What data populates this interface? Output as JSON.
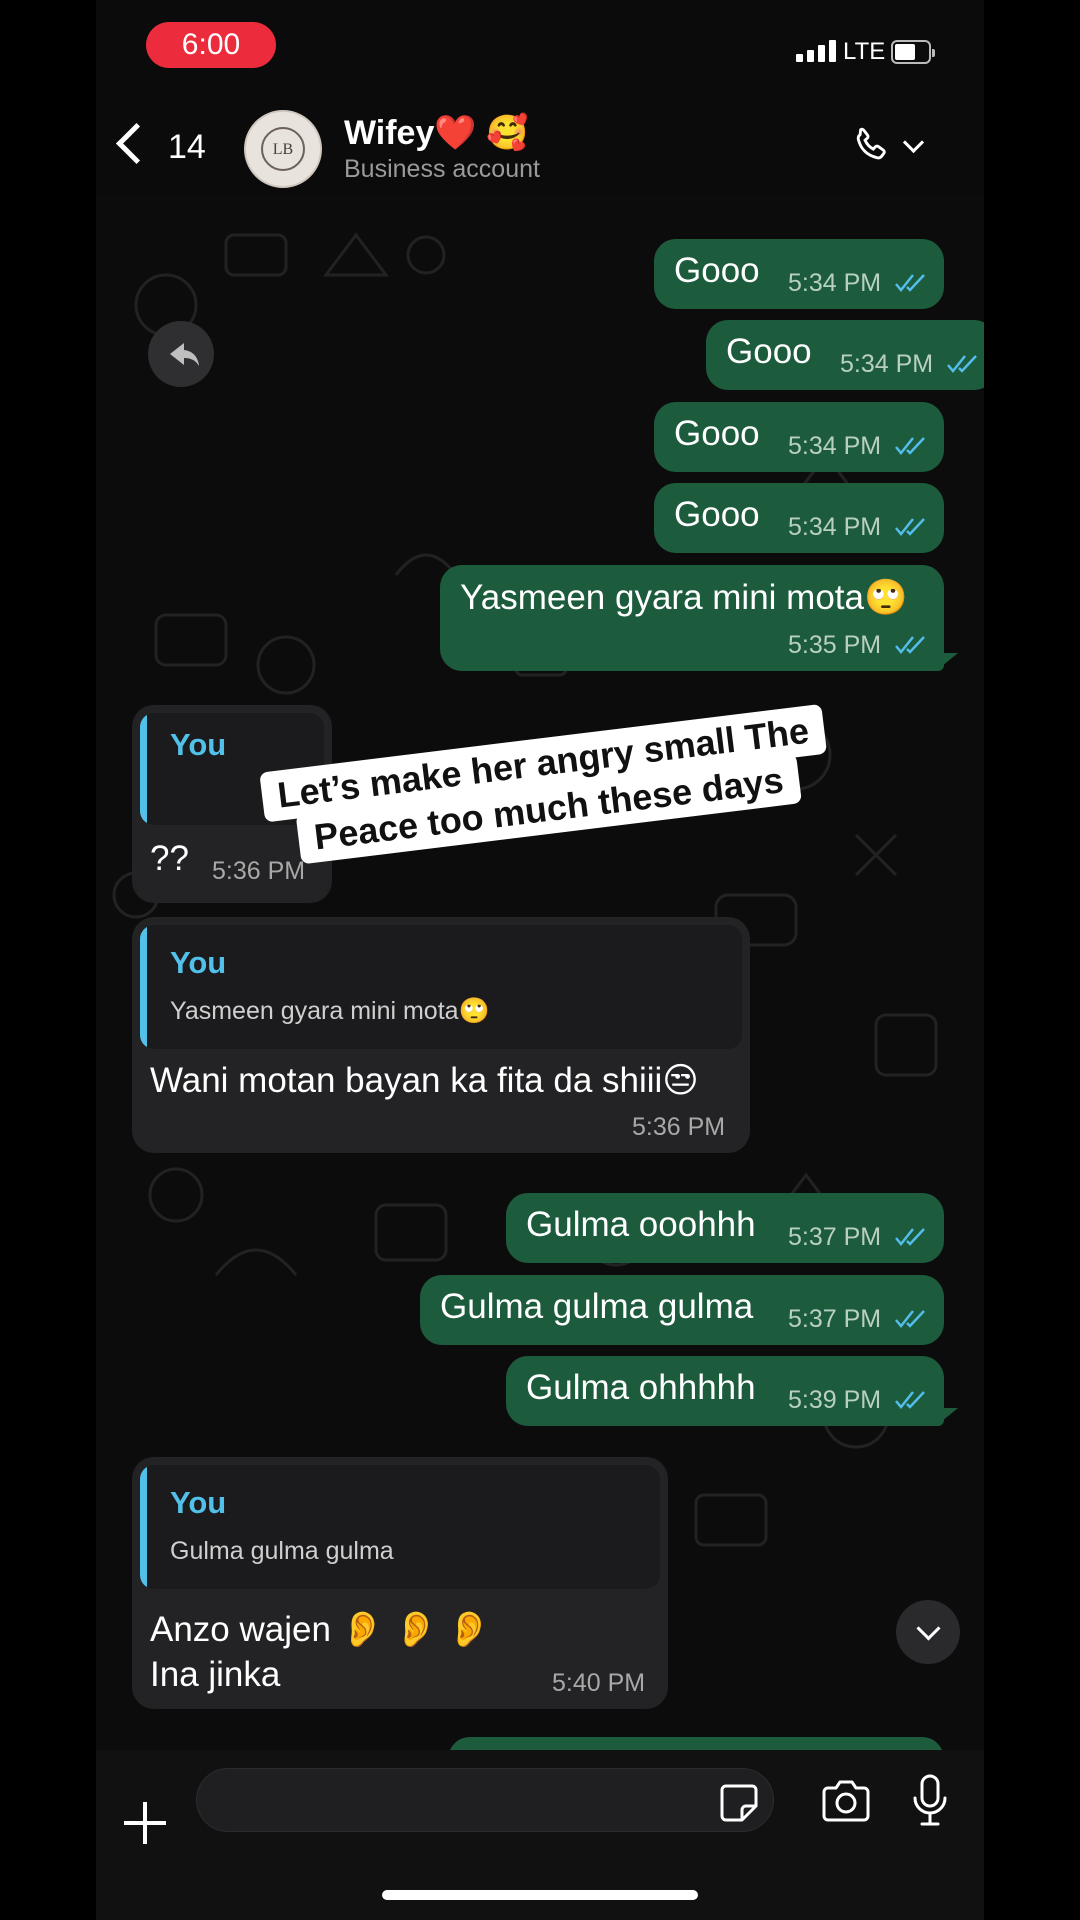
{
  "status_bar": {
    "time": "6:00",
    "network": "LTE"
  },
  "header": {
    "back_count": "14",
    "contact_name": "Wifey❤️ 🥰",
    "subtitle": "Business account",
    "avatar_text": "LB"
  },
  "messages": [
    {
      "id": "m1",
      "text": "Gooo",
      "time": "5:34 PM"
    },
    {
      "id": "m2",
      "text": "Gooo",
      "time": "5:34 PM"
    },
    {
      "id": "m3",
      "text": "Gooo",
      "time": "5:34 PM"
    },
    {
      "id": "m4",
      "text": "Gooo",
      "time": "5:34 PM"
    },
    {
      "id": "m5",
      "text": "Yasmeen gyara mini mota🙄",
      "time": "5:35 PM"
    },
    {
      "id": "m6",
      "quote_author": "You",
      "text": "??",
      "time": "5:36 PM"
    },
    {
      "id": "m7",
      "quote_author": "You",
      "quote_text": "Yasmeen gyara mini mota🙄",
      "text": "Wani motan bayan ka fita da shiii😒",
      "time": "5:36 PM"
    },
    {
      "id": "m8",
      "text": "Gulma ooohhh",
      "time": "5:37 PM"
    },
    {
      "id": "m9",
      "text": "Gulma gulma gulma",
      "time": "5:37 PM"
    },
    {
      "id": "m10",
      "text": "Gulma ohhhhh",
      "time": "5:39 PM"
    },
    {
      "id": "m11",
      "quote_author": "You",
      "quote_text": "Gulma gulma gulma",
      "text_line1": "Anzo wajen 👂 👂 👂",
      "text_line2": "Ina jinka",
      "time": "5:40 PM"
    }
  ],
  "overlay_caption": {
    "line1": "Let’s make her angry small The",
    "line2": "Peace too much these days"
  },
  "colors": {
    "outgoing": "#1d5b3d",
    "incoming": "#232325",
    "quote_accent": "#52c1ea",
    "time_pill": "#ec2c3c",
    "read_ticks": "#53bdeb"
  }
}
